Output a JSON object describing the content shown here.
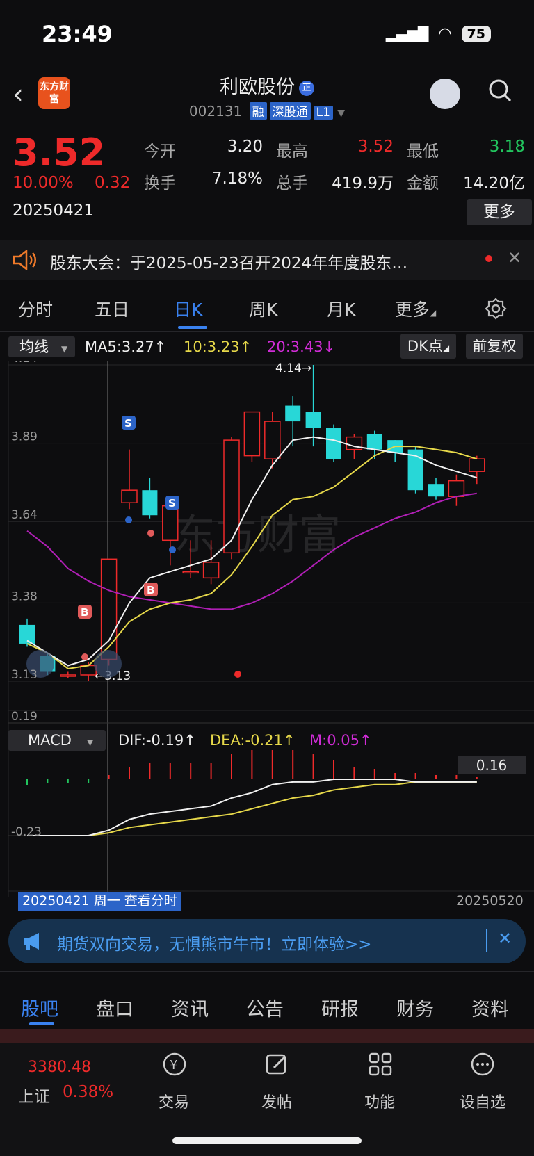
{
  "status_bar": {
    "time": "23:49",
    "battery": "75"
  },
  "header": {
    "logo_text": "东方财富",
    "title": "利欧股份",
    "title_badge": "正",
    "code": "002131",
    "tags": [
      "融",
      "深股通",
      "L1"
    ]
  },
  "quote": {
    "price": "3.52",
    "change_pct": "10.00%",
    "change": "0.32",
    "date": "20250421",
    "fields": [
      {
        "label": "今开",
        "value": "3.20",
        "color": "#eeeeee"
      },
      {
        "label": "最高",
        "value": "3.52",
        "color": "#ee2a2a"
      },
      {
        "label": "最低",
        "value": "3.18",
        "color": "#22c55e"
      },
      {
        "label": "换手",
        "value": "7.18%",
        "color": "#eeeeee"
      },
      {
        "label": "总手",
        "value": "419.9万",
        "color": "#eeeeee"
      },
      {
        "label": "金额",
        "value": "14.20亿",
        "color": "#eeeeee"
      }
    ],
    "more_label": "更多"
  },
  "notice": {
    "text": "股东大会：于2025-05-23召开2024年年度股东…"
  },
  "chart_tabs": {
    "items": [
      "分时",
      "五日",
      "日K",
      "周K",
      "月K",
      "更多"
    ],
    "active": "日K"
  },
  "indicator_bar": {
    "select": "均线",
    "ma5": "MA5:3.27↑",
    "ma10": "10:3.23↑",
    "ma20": "20:3.43↓",
    "dk": "DK点",
    "fq": "前复权"
  },
  "macd_bar": {
    "select": "MACD",
    "dif": "DIF:-0.19↑",
    "dea": "DEA:-0.21↑",
    "m": "M:0.05↑"
  },
  "chart_data": {
    "type": "candlestick",
    "price_axis_labels": [
      "4.14",
      "3.89",
      "3.64",
      "3.38",
      "3.13"
    ],
    "ylim": [
      3.13,
      4.14
    ],
    "candles": [
      {
        "o": 3.31,
        "c": 3.25,
        "h": 3.33,
        "l": 3.24
      },
      {
        "o": 3.21,
        "c": 3.16,
        "h": 3.22,
        "l": 3.15
      },
      {
        "o": 3.15,
        "c": 3.15,
        "h": 3.16,
        "l": 3.14
      },
      {
        "o": 3.15,
        "c": 3.18,
        "h": 3.19,
        "l": 3.13
      },
      {
        "o": 3.2,
        "c": 3.52,
        "h": 3.52,
        "l": 3.18
      },
      {
        "o": 3.7,
        "c": 3.74,
        "h": 3.87,
        "l": 3.68
      },
      {
        "o": 3.74,
        "c": 3.66,
        "h": 3.78,
        "l": 3.65
      },
      {
        "o": 3.58,
        "c": 3.69,
        "h": 3.7,
        "l": 3.5
      },
      {
        "o": 3.48,
        "c": 3.48,
        "h": 3.58,
        "l": 3.46
      },
      {
        "o": 3.46,
        "c": 3.51,
        "h": 3.58,
        "l": 3.44
      },
      {
        "o": 3.54,
        "c": 3.9,
        "h": 3.91,
        "l": 3.52
      },
      {
        "o": 3.85,
        "c": 3.99,
        "h": 3.91,
        "l": 3.83
      },
      {
        "o": 3.84,
        "c": 3.96,
        "h": 3.99,
        "l": 3.81
      },
      {
        "o": 4.01,
        "c": 3.96,
        "h": 4.04,
        "l": 3.88
      },
      {
        "o": 3.99,
        "c": 3.94,
        "h": 4.14,
        "l": 3.88
      },
      {
        "o": 3.94,
        "c": 3.84,
        "h": 3.95,
        "l": 3.83
      },
      {
        "o": 3.87,
        "c": 3.91,
        "h": 3.92,
        "l": 3.84
      },
      {
        "o": 3.92,
        "c": 3.87,
        "h": 3.93,
        "l": 3.84
      },
      {
        "o": 3.9,
        "c": 3.86,
        "h": 3.9,
        "l": 3.83
      },
      {
        "o": 3.87,
        "c": 3.74,
        "h": 3.88,
        "l": 3.73
      },
      {
        "o": 3.76,
        "c": 3.72,
        "h": 3.78,
        "l": 3.71
      },
      {
        "o": 3.72,
        "c": 3.77,
        "h": 3.79,
        "l": 3.69
      },
      {
        "o": 3.8,
        "c": 3.84,
        "h": 3.85,
        "l": 3.76
      }
    ],
    "ma5": [
      3.26,
      3.22,
      3.18,
      3.2,
      3.26,
      3.38,
      3.46,
      3.48,
      3.5,
      3.52,
      3.58,
      3.71,
      3.82,
      3.9,
      3.91,
      3.9,
      3.88,
      3.87,
      3.86,
      3.85,
      3.82,
      3.8,
      3.78
    ],
    "ma10": [
      3.25,
      3.22,
      3.17,
      3.18,
      3.24,
      3.32,
      3.36,
      3.38,
      3.39,
      3.41,
      3.47,
      3.56,
      3.66,
      3.71,
      3.72,
      3.75,
      3.8,
      3.85,
      3.88,
      3.88,
      3.87,
      3.86,
      3.84
    ],
    "ma20": [
      3.61,
      3.56,
      3.49,
      3.45,
      3.42,
      3.4,
      3.39,
      3.38,
      3.37,
      3.36,
      3.36,
      3.38,
      3.41,
      3.45,
      3.5,
      3.55,
      3.59,
      3.62,
      3.65,
      3.67,
      3.7,
      3.72,
      3.73
    ],
    "annotations": {
      "high": "4.14→",
      "low": "←3.13"
    },
    "macd_axis_labels": [
      "0.19",
      "-0.23"
    ],
    "macd_marker": "0.16",
    "macd_ylim": [
      -0.23,
      0.19
    ],
    "dif": [
      -0.23,
      -0.23,
      -0.23,
      -0.23,
      -0.21,
      -0.17,
      -0.15,
      -0.14,
      -0.13,
      -0.12,
      -0.09,
      -0.07,
      -0.04,
      -0.03,
      -0.03,
      -0.02,
      -0.02,
      -0.02,
      -0.02,
      -0.03,
      -0.03,
      -0.03,
      -0.03
    ],
    "dea": [
      -0.23,
      -0.23,
      -0.23,
      -0.23,
      -0.22,
      -0.2,
      -0.19,
      -0.18,
      -0.17,
      -0.16,
      -0.15,
      -0.13,
      -0.11,
      -0.09,
      -0.08,
      -0.06,
      -0.05,
      -0.04,
      -0.04,
      -0.03,
      -0.03,
      -0.03,
      -0.03
    ],
    "macd": [
      -0.03,
      -0.02,
      -0.02,
      -0.02,
      0.02,
      0.06,
      0.08,
      0.08,
      0.08,
      0.08,
      0.12,
      0.14,
      0.14,
      0.14,
      0.12,
      0.09,
      0.06,
      0.05,
      0.03,
      0.03,
      0.02,
      0.02,
      0.01
    ],
    "x_start_label": "20250421 周一 查看分时",
    "x_end_label": "20250520"
  },
  "ad": {
    "text": "期货双向交易，无惧熊市牛市！立即体验>>"
  },
  "bottom_tabs": {
    "items": [
      "股吧",
      "盘口",
      "资讯",
      "公告",
      "研报",
      "财务",
      "资料"
    ],
    "active": "股吧"
  },
  "footer": {
    "index_value": "3380.48",
    "index_name": "上证",
    "index_pct": "0.38%",
    "items": [
      "交易",
      "发帖",
      "功能",
      "设自选"
    ]
  }
}
